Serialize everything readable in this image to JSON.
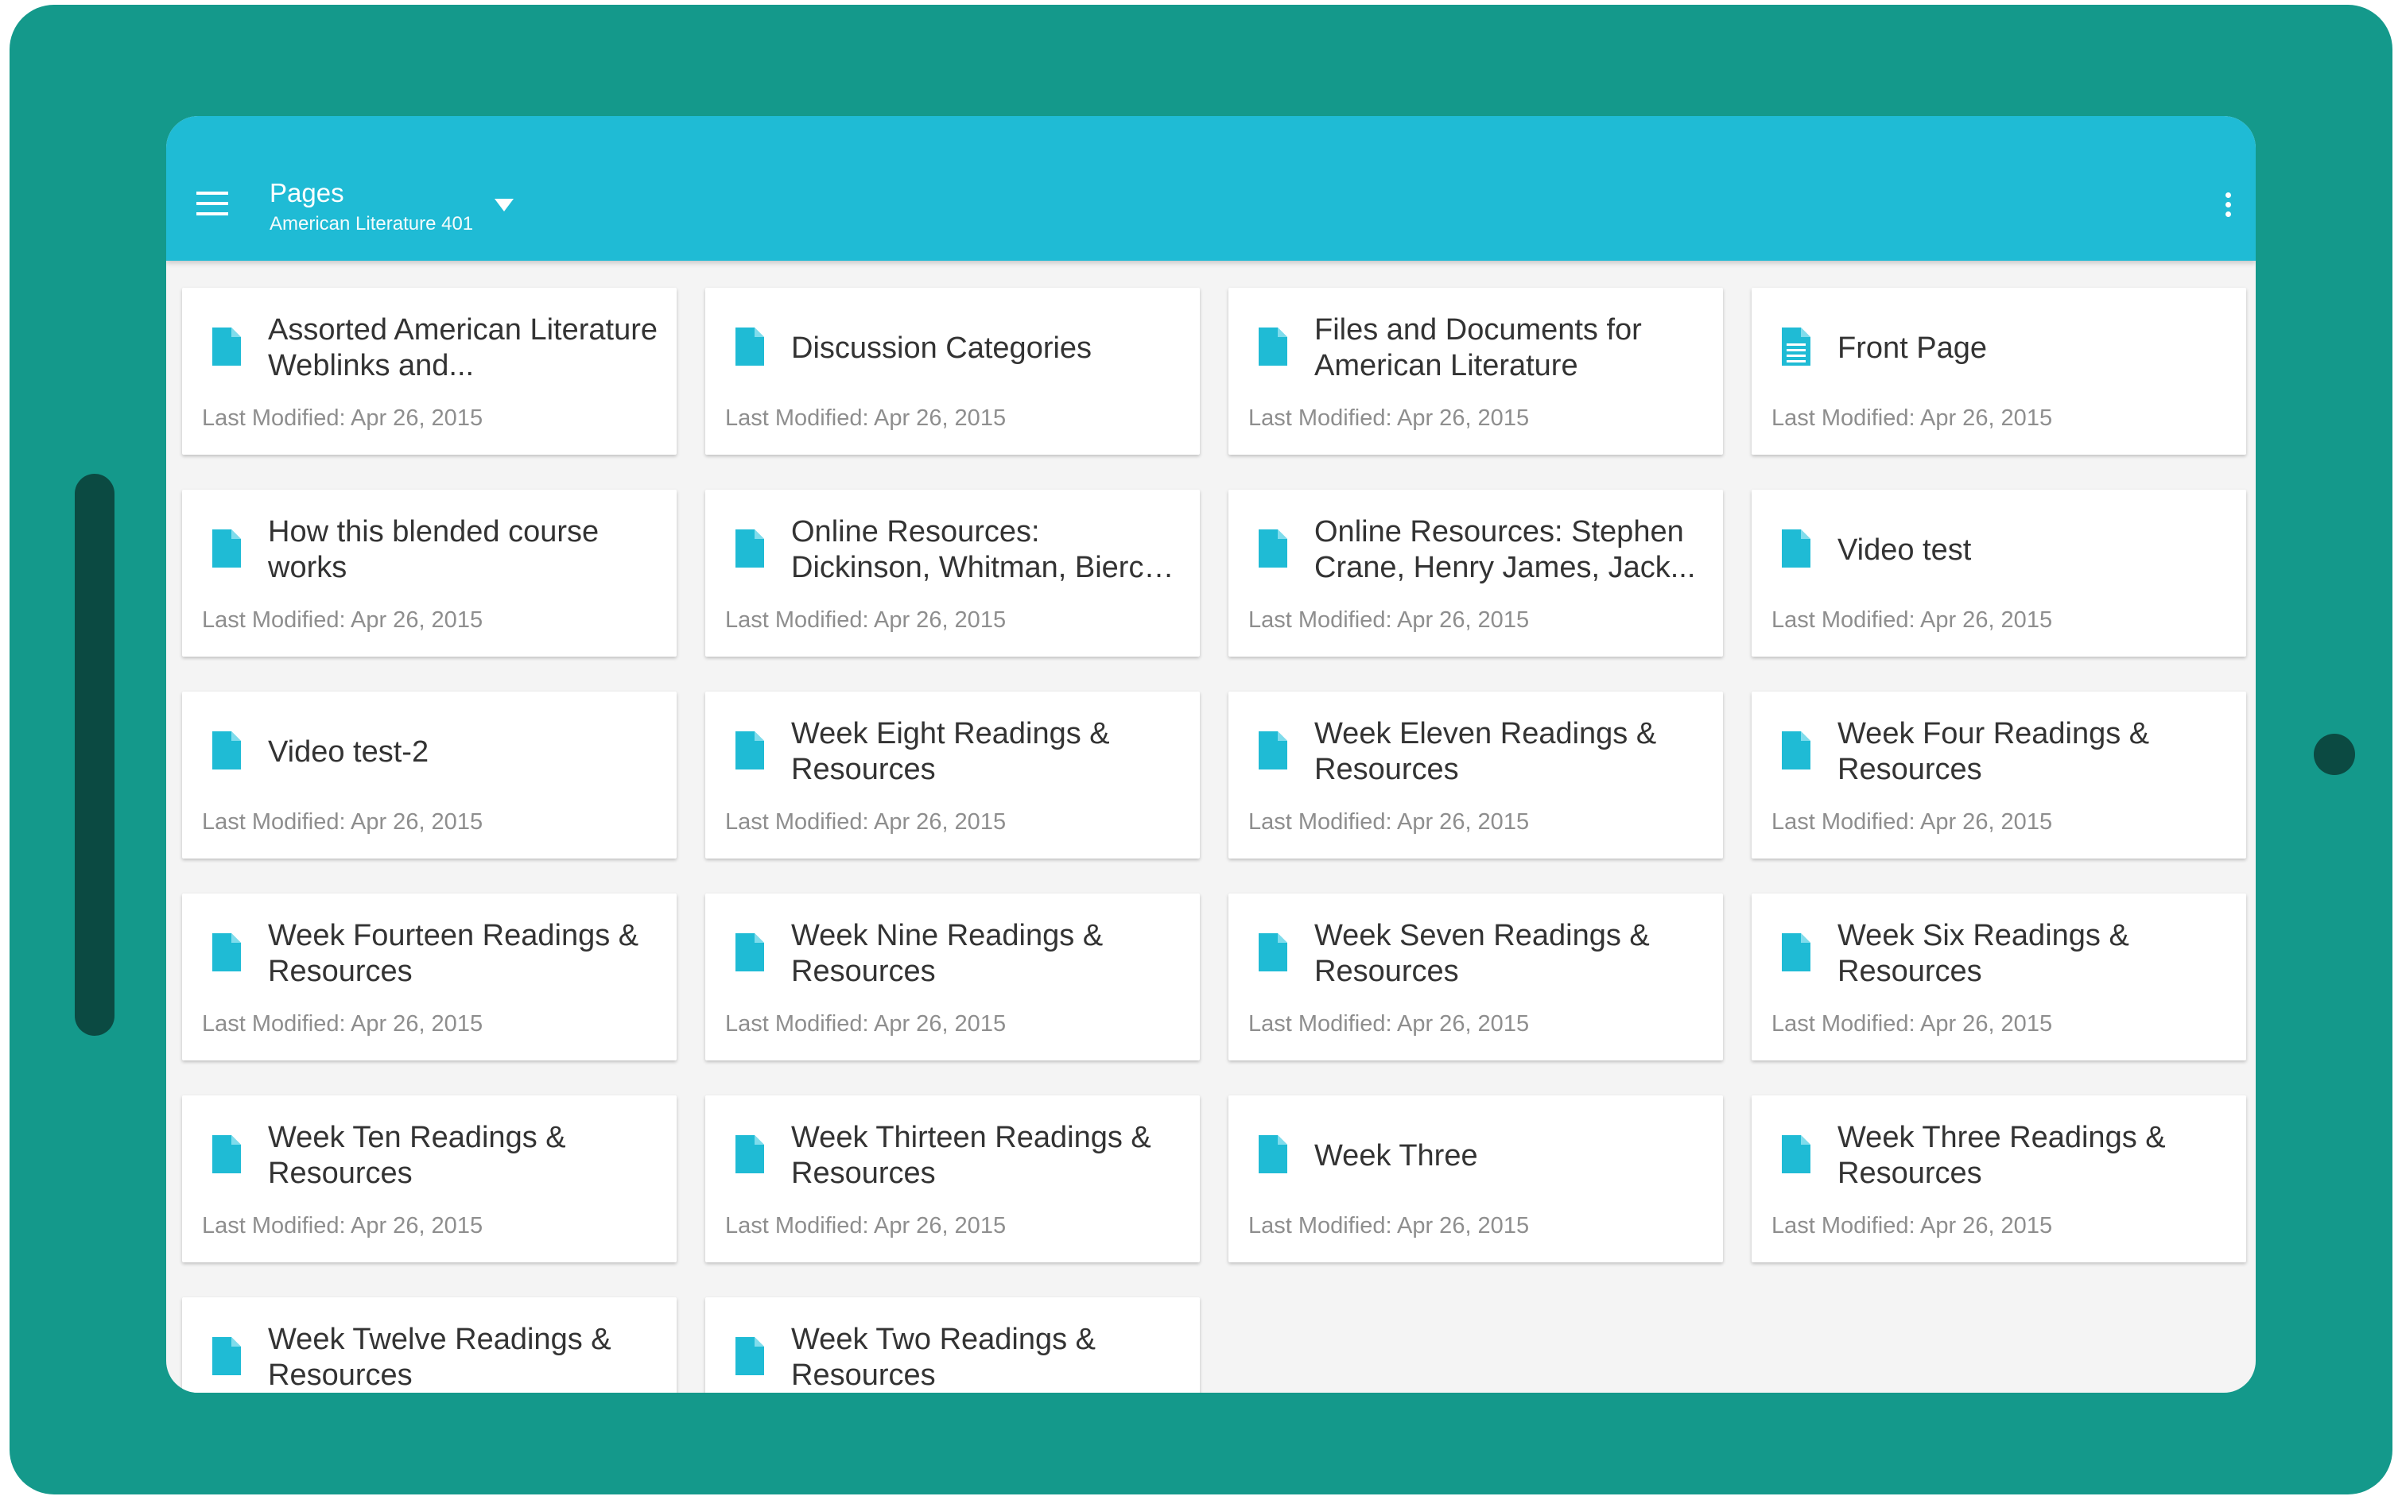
{
  "appbar": {
    "title": "Pages",
    "subtitle": "American Literature 401"
  },
  "pages": [
    {
      "title": "Assorted American Literature Weblinks and...",
      "modified": "Last Modified: Apr 26, 2015",
      "icon": "document-icon"
    },
    {
      "title": "Discussion Categories",
      "modified": "Last Modified: Apr 26, 2015",
      "icon": "document-icon"
    },
    {
      "title": "Files and Documents for American Literature",
      "modified": "Last Modified: Apr 26, 2015",
      "icon": "document-icon"
    },
    {
      "title": "Front Page",
      "modified": "Last Modified: Apr 26, 2015",
      "icon": "front-page-document-icon"
    },
    {
      "title": "How this blended course works",
      "modified": "Last Modified: Apr 26, 2015",
      "icon": "document-icon"
    },
    {
      "title": "Online Resources: Dickinson, Whitman, Bierce, Freeman",
      "modified": "Last Modified: Apr 26, 2015",
      "icon": "document-icon"
    },
    {
      "title": "Online Resources: Stephen Crane, Henry James, Jack...",
      "modified": "Last Modified: Apr 26, 2015",
      "icon": "document-icon"
    },
    {
      "title": "Video test",
      "modified": "Last Modified: Apr 26, 2015",
      "icon": "document-icon"
    },
    {
      "title": "Video test-2",
      "modified": "Last Modified: Apr 26, 2015",
      "icon": "document-icon"
    },
    {
      "title": "Week Eight Readings & Resources",
      "modified": "Last Modified: Apr 26, 2015",
      "icon": "document-icon"
    },
    {
      "title": "Week Eleven Readings & Resources",
      "modified": "Last Modified: Apr 26, 2015",
      "icon": "document-icon"
    },
    {
      "title": "Week Four Readings & Resources",
      "modified": "Last Modified: Apr 26, 2015",
      "icon": "document-icon"
    },
    {
      "title": "Week Fourteen Readings & Resources",
      "modified": "Last Modified: Apr 26, 2015",
      "icon": "document-icon"
    },
    {
      "title": "Week Nine Readings & Resources",
      "modified": "Last Modified: Apr 26, 2015",
      "icon": "document-icon"
    },
    {
      "title": "Week Seven Readings & Resources",
      "modified": "Last Modified: Apr 26, 2015",
      "icon": "document-icon"
    },
    {
      "title": "Week Six Readings & Resources",
      "modified": "Last Modified: Apr 26, 2015",
      "icon": "document-icon"
    },
    {
      "title": "Week Ten Readings & Resources",
      "modified": "Last Modified: Apr 26, 2015",
      "icon": "document-icon"
    },
    {
      "title": "Week Thirteen Readings & Resources",
      "modified": "Last Modified: Apr 26, 2015",
      "icon": "document-icon"
    },
    {
      "title": "Week Three",
      "modified": "Last Modified: Apr 26, 2015",
      "icon": "document-icon"
    },
    {
      "title": "Week Three Readings & Resources",
      "modified": "Last Modified: Apr 26, 2015",
      "icon": "document-icon"
    },
    {
      "title": "Week Twelve Readings & Resources",
      "modified": "",
      "icon": "document-icon"
    },
    {
      "title": "Week Two Readings & Resources",
      "modified": "",
      "icon": "document-icon"
    }
  ],
  "colors": {
    "accent": "#1fbbd5",
    "frame": "#14998b",
    "frame_dark": "#0b4a42",
    "title_text": "#333333",
    "meta_text": "#8e8e8e"
  }
}
